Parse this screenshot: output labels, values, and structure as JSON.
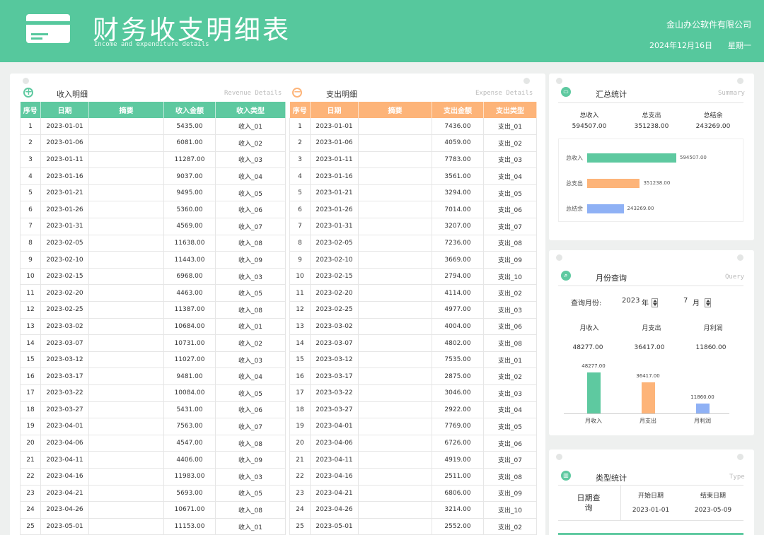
{
  "header": {
    "title": "财务收支明细表",
    "subtitle": "Income and expenditure details",
    "company": "金山办公软件有限公司",
    "date": "2024年12月16日",
    "weekday": "星期一"
  },
  "income": {
    "title": "收入明细",
    "title_en": "Revenue Details",
    "columns": [
      "序号",
      "日期",
      "摘要",
      "收入金额",
      "收入类型"
    ],
    "rows": [
      [
        "1",
        "2023-01-01",
        "",
        "5435.00",
        "收入_01"
      ],
      [
        "2",
        "2023-01-06",
        "",
        "6081.00",
        "收入_02"
      ],
      [
        "3",
        "2023-01-11",
        "",
        "11287.00",
        "收入_03"
      ],
      [
        "4",
        "2023-01-16",
        "",
        "9037.00",
        "收入_04"
      ],
      [
        "5",
        "2023-01-21",
        "",
        "9495.00",
        "收入_05"
      ],
      [
        "6",
        "2023-01-26",
        "",
        "5360.00",
        "收入_06"
      ],
      [
        "7",
        "2023-01-31",
        "",
        "4569.00",
        "收入_07"
      ],
      [
        "8",
        "2023-02-05",
        "",
        "11638.00",
        "收入_08"
      ],
      [
        "9",
        "2023-02-10",
        "",
        "11443.00",
        "收入_09"
      ],
      [
        "10",
        "2023-02-15",
        "",
        "6968.00",
        "收入_03"
      ],
      [
        "11",
        "2023-02-20",
        "",
        "4463.00",
        "收入_05"
      ],
      [
        "12",
        "2023-02-25",
        "",
        "11387.00",
        "收入_08"
      ],
      [
        "13",
        "2023-03-02",
        "",
        "10684.00",
        "收入_01"
      ],
      [
        "14",
        "2023-03-07",
        "",
        "10731.00",
        "收入_02"
      ],
      [
        "15",
        "2023-03-12",
        "",
        "11027.00",
        "收入_03"
      ],
      [
        "16",
        "2023-03-17",
        "",
        "9481.00",
        "收入_04"
      ],
      [
        "17",
        "2023-03-22",
        "",
        "10084.00",
        "收入_05"
      ],
      [
        "18",
        "2023-03-27",
        "",
        "5431.00",
        "收入_06"
      ],
      [
        "19",
        "2023-04-01",
        "",
        "7563.00",
        "收入_07"
      ],
      [
        "20",
        "2023-04-06",
        "",
        "4547.00",
        "收入_08"
      ],
      [
        "21",
        "2023-04-11",
        "",
        "4406.00",
        "收入_09"
      ],
      [
        "22",
        "2023-04-16",
        "",
        "11983.00",
        "收入_03"
      ],
      [
        "23",
        "2023-04-21",
        "",
        "5693.00",
        "收入_05"
      ],
      [
        "24",
        "2023-04-26",
        "",
        "10671.00",
        "收入_08"
      ],
      [
        "25",
        "2023-05-01",
        "",
        "11153.00",
        "收入_01"
      ]
    ]
  },
  "expense": {
    "title": "支出明细",
    "title_en": "Expense Details",
    "columns": [
      "序号",
      "日期",
      "摘要",
      "支出金额",
      "支出类型"
    ],
    "rows": [
      [
        "1",
        "2023-01-01",
        "",
        "7436.00",
        "支出_01"
      ],
      [
        "2",
        "2023-01-06",
        "",
        "4059.00",
        "支出_02"
      ],
      [
        "3",
        "2023-01-11",
        "",
        "7783.00",
        "支出_03"
      ],
      [
        "4",
        "2023-01-16",
        "",
        "3561.00",
        "支出_04"
      ],
      [
        "5",
        "2023-01-21",
        "",
        "3294.00",
        "支出_05"
      ],
      [
        "6",
        "2023-01-26",
        "",
        "7014.00",
        "支出_06"
      ],
      [
        "7",
        "2023-01-31",
        "",
        "3207.00",
        "支出_07"
      ],
      [
        "8",
        "2023-02-05",
        "",
        "7236.00",
        "支出_08"
      ],
      [
        "9",
        "2023-02-10",
        "",
        "3669.00",
        "支出_09"
      ],
      [
        "10",
        "2023-02-15",
        "",
        "2794.00",
        "支出_10"
      ],
      [
        "11",
        "2023-02-20",
        "",
        "4114.00",
        "支出_02"
      ],
      [
        "12",
        "2023-02-25",
        "",
        "4977.00",
        "支出_03"
      ],
      [
        "13",
        "2023-03-02",
        "",
        "4004.00",
        "支出_06"
      ],
      [
        "14",
        "2023-03-07",
        "",
        "4802.00",
        "支出_08"
      ],
      [
        "15",
        "2023-03-12",
        "",
        "7535.00",
        "支出_01"
      ],
      [
        "16",
        "2023-03-17",
        "",
        "2875.00",
        "支出_02"
      ],
      [
        "17",
        "2023-03-22",
        "",
        "3046.00",
        "支出_03"
      ],
      [
        "18",
        "2023-03-27",
        "",
        "2922.00",
        "支出_04"
      ],
      [
        "19",
        "2023-04-01",
        "",
        "7769.00",
        "支出_05"
      ],
      [
        "20",
        "2023-04-06",
        "",
        "6726.00",
        "支出_06"
      ],
      [
        "21",
        "2023-04-11",
        "",
        "4919.00",
        "支出_07"
      ],
      [
        "22",
        "2023-04-16",
        "",
        "2511.00",
        "支出_08"
      ],
      [
        "23",
        "2023-04-21",
        "",
        "6806.00",
        "支出_09"
      ],
      [
        "24",
        "2023-04-26",
        "",
        "3214.00",
        "支出_10"
      ],
      [
        "25",
        "2023-05-01",
        "",
        "2552.00",
        "支出_02"
      ]
    ]
  },
  "summary": {
    "title": "汇总统计",
    "title_en": "Summary",
    "labels": [
      "总收入",
      "总支出",
      "总结余"
    ],
    "values": [
      "594507.00",
      "351238.00",
      "243269.00"
    ]
  },
  "query": {
    "title": "月份查询",
    "title_en": "Query",
    "label": "查询月份:",
    "year": "2023",
    "year_unit": "年",
    "month": "7",
    "month_unit": "月",
    "labels": [
      "月收入",
      "月支出",
      "月利润"
    ],
    "values": [
      "48277.00",
      "36417.00",
      "11860.00"
    ]
  },
  "type_stats": {
    "title": "类型统计",
    "title_en": "Type",
    "row_label": "日期查询",
    "col_start": "开始日期",
    "col_end": "结束日期",
    "start": "2023-01-01",
    "end": "2023-05-09"
  },
  "colors": {
    "income": "#5ec9a0",
    "expense": "#fdb479",
    "balance": "#8fb1f5",
    "header": "#56c89d"
  },
  "chart_data": [
    {
      "type": "bar",
      "orientation": "horizontal",
      "categories": [
        "总收入",
        "总支出",
        "总结余"
      ],
      "values": [
        594507,
        351238,
        243269
      ],
      "labels": [
        "594507.00",
        "351238.00",
        "243269.00"
      ],
      "grid": false
    },
    {
      "type": "bar",
      "categories": [
        "月收入",
        "月支出",
        "月利润"
      ],
      "values": [
        48277,
        36417,
        11860
      ],
      "labels": [
        "48277.00",
        "36417.00",
        "11860.00"
      ],
      "grid": false
    }
  ]
}
